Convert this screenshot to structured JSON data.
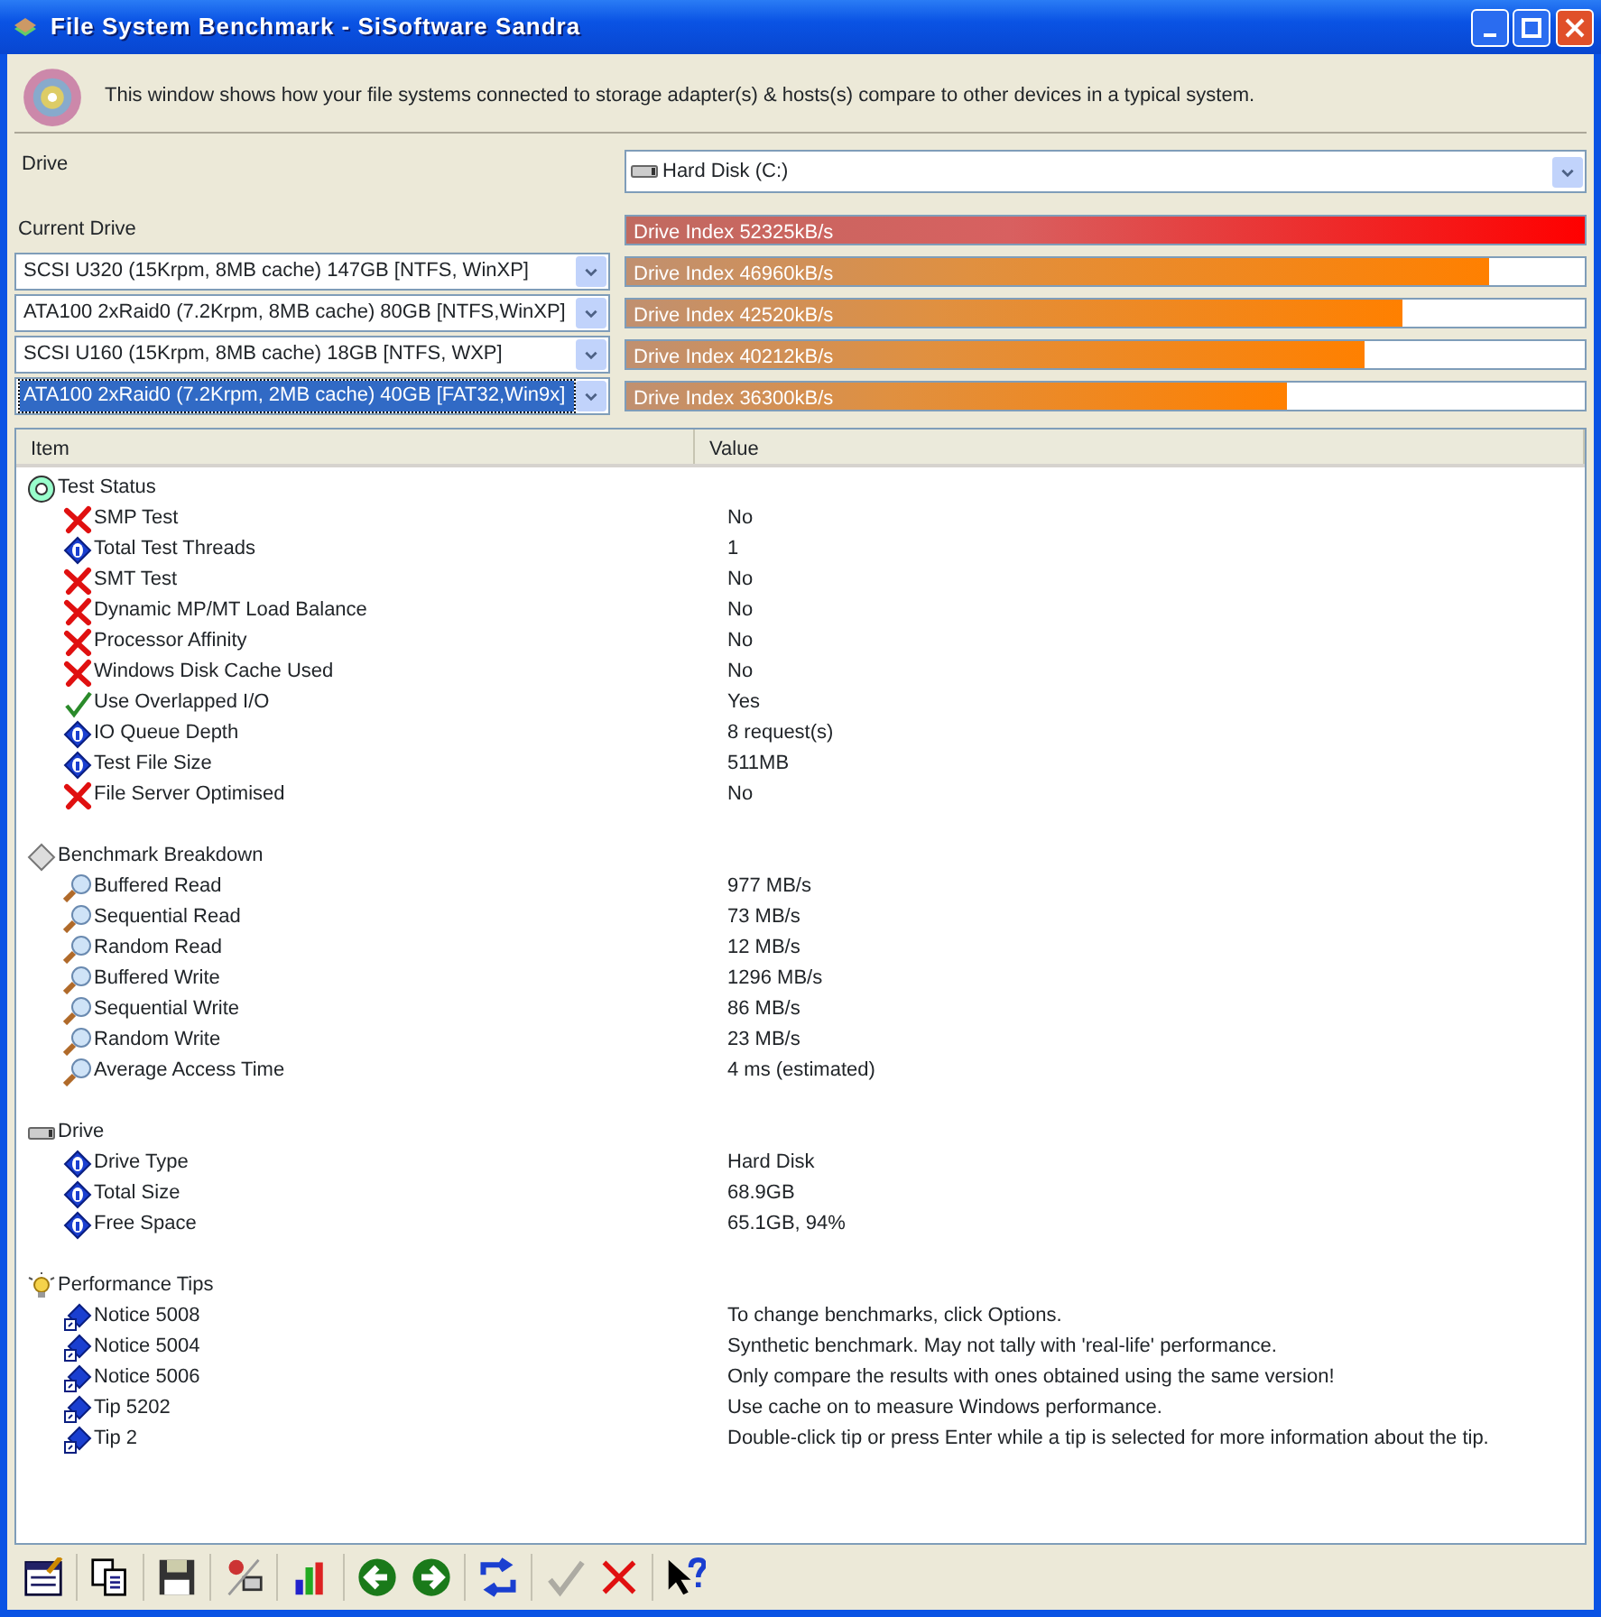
{
  "window": {
    "title": "File System Benchmark - SiSoftware Sandra"
  },
  "description": "This window shows how your file systems connected to storage adapter(s) & hosts(s) compare to other devices in a typical system.",
  "drive": {
    "label": "Drive",
    "value": "Hard Disk (C:)"
  },
  "current": {
    "label": "Current Drive",
    "bar_text": "Drive Index 52325kB/s",
    "level": 1.0
  },
  "comparisons": [
    {
      "value": "SCSI U320 (15Krpm, 8MB cache) 147GB [NTFS, WinXP]",
      "selected": false,
      "bar_text": "Drive Index 46960kB/s",
      "level": 0.9
    },
    {
      "value": "ATA100 2xRaid0 (7.2Krpm, 8MB cache) 80GB [NTFS,WinXP]",
      "selected": false,
      "bar_text": "Drive Index 42520kB/s",
      "level": 0.81
    },
    {
      "value": "SCSI U160 (15Krpm, 8MB cache) 18GB [NTFS, WXP]",
      "selected": false,
      "bar_text": "Drive Index 40212kB/s",
      "level": 0.77
    },
    {
      "value": "ATA100 2xRaid0 (7.2Krpm, 2MB cache) 40GB [FAT32,Win9x]",
      "selected": true,
      "bar_text": "Drive Index 36300kB/s",
      "level": 0.69
    }
  ],
  "table": {
    "columns": [
      "Item",
      "Value"
    ],
    "sections": [
      {
        "kind": "status",
        "title": "Test Status",
        "children": [
          {
            "kind": "cross",
            "item": "SMP Test",
            "value": "No"
          },
          {
            "kind": "info",
            "item": "Total Test Threads",
            "value": "1"
          },
          {
            "kind": "cross",
            "item": "SMT Test",
            "value": "No"
          },
          {
            "kind": "cross",
            "item": "Dynamic MP/MT Load Balance",
            "value": "No"
          },
          {
            "kind": "cross",
            "item": "Processor Affinity",
            "value": "No"
          },
          {
            "kind": "cross",
            "item": "Windows Disk Cache Used",
            "value": "No"
          },
          {
            "kind": "check",
            "item": "Use Overlapped I/O",
            "value": "Yes"
          },
          {
            "kind": "info",
            "item": "IO Queue Depth",
            "value": "8 request(s)"
          },
          {
            "kind": "info",
            "item": "Test File Size",
            "value": "511MB"
          },
          {
            "kind": "cross",
            "item": "File Server Optimised",
            "value": "No"
          }
        ]
      },
      {
        "kind": "breakdown",
        "title": "Benchmark Breakdown",
        "children": [
          {
            "kind": "probe",
            "item": "Buffered Read",
            "value": "977 MB/s"
          },
          {
            "kind": "probe",
            "item": "Sequential Read",
            "value": "73 MB/s"
          },
          {
            "kind": "probe",
            "item": "Random Read",
            "value": "12 MB/s"
          },
          {
            "kind": "probe",
            "item": "Buffered Write",
            "value": "1296 MB/s"
          },
          {
            "kind": "probe",
            "item": "Sequential Write",
            "value": "86 MB/s"
          },
          {
            "kind": "probe",
            "item": "Random Write",
            "value": "23 MB/s"
          },
          {
            "kind": "probe",
            "item": "Average Access Time",
            "value": "4 ms (estimated)"
          }
        ]
      },
      {
        "kind": "drive",
        "title": "Drive",
        "children": [
          {
            "kind": "info",
            "item": "Drive Type",
            "value": "Hard Disk"
          },
          {
            "kind": "info",
            "item": "Total Size",
            "value": "68.9GB"
          },
          {
            "kind": "info",
            "item": "Free Space",
            "value": "65.1GB, 94%"
          }
        ]
      },
      {
        "kind": "tips",
        "title": "Performance Tips",
        "children": [
          {
            "kind": "tip",
            "item": "Notice 5008",
            "value": "To change benchmarks, click Options."
          },
          {
            "kind": "tip",
            "item": "Notice 5004",
            "value": "Synthetic benchmark. May not tally with 'real-life' performance."
          },
          {
            "kind": "tip",
            "item": "Notice 5006",
            "value": "Only compare the results with ones obtained using the same version!"
          },
          {
            "kind": "tip",
            "item": "Tip 5202",
            "value": "Use cache on to measure Windows performance."
          },
          {
            "kind": "tip",
            "item": "Tip 2",
            "value": "Double-click tip or press Enter while a tip is selected for more information about the tip."
          }
        ]
      }
    ]
  },
  "toolbar": [
    {
      "kind": "report",
      "disabled": false
    },
    {
      "kind": "copy",
      "disabled": false
    },
    {
      "kind": "save",
      "disabled": false
    },
    {
      "kind": "options",
      "disabled": false
    },
    {
      "kind": "chart",
      "disabled": false
    },
    {
      "kind": "back",
      "disabled": false
    },
    {
      "kind": "forward",
      "disabled": false
    },
    {
      "kind": "refresh",
      "disabled": false
    },
    {
      "kind": "ok",
      "disabled": true
    },
    {
      "kind": "cancel",
      "disabled": false
    },
    {
      "kind": "help",
      "disabled": false
    }
  ]
}
